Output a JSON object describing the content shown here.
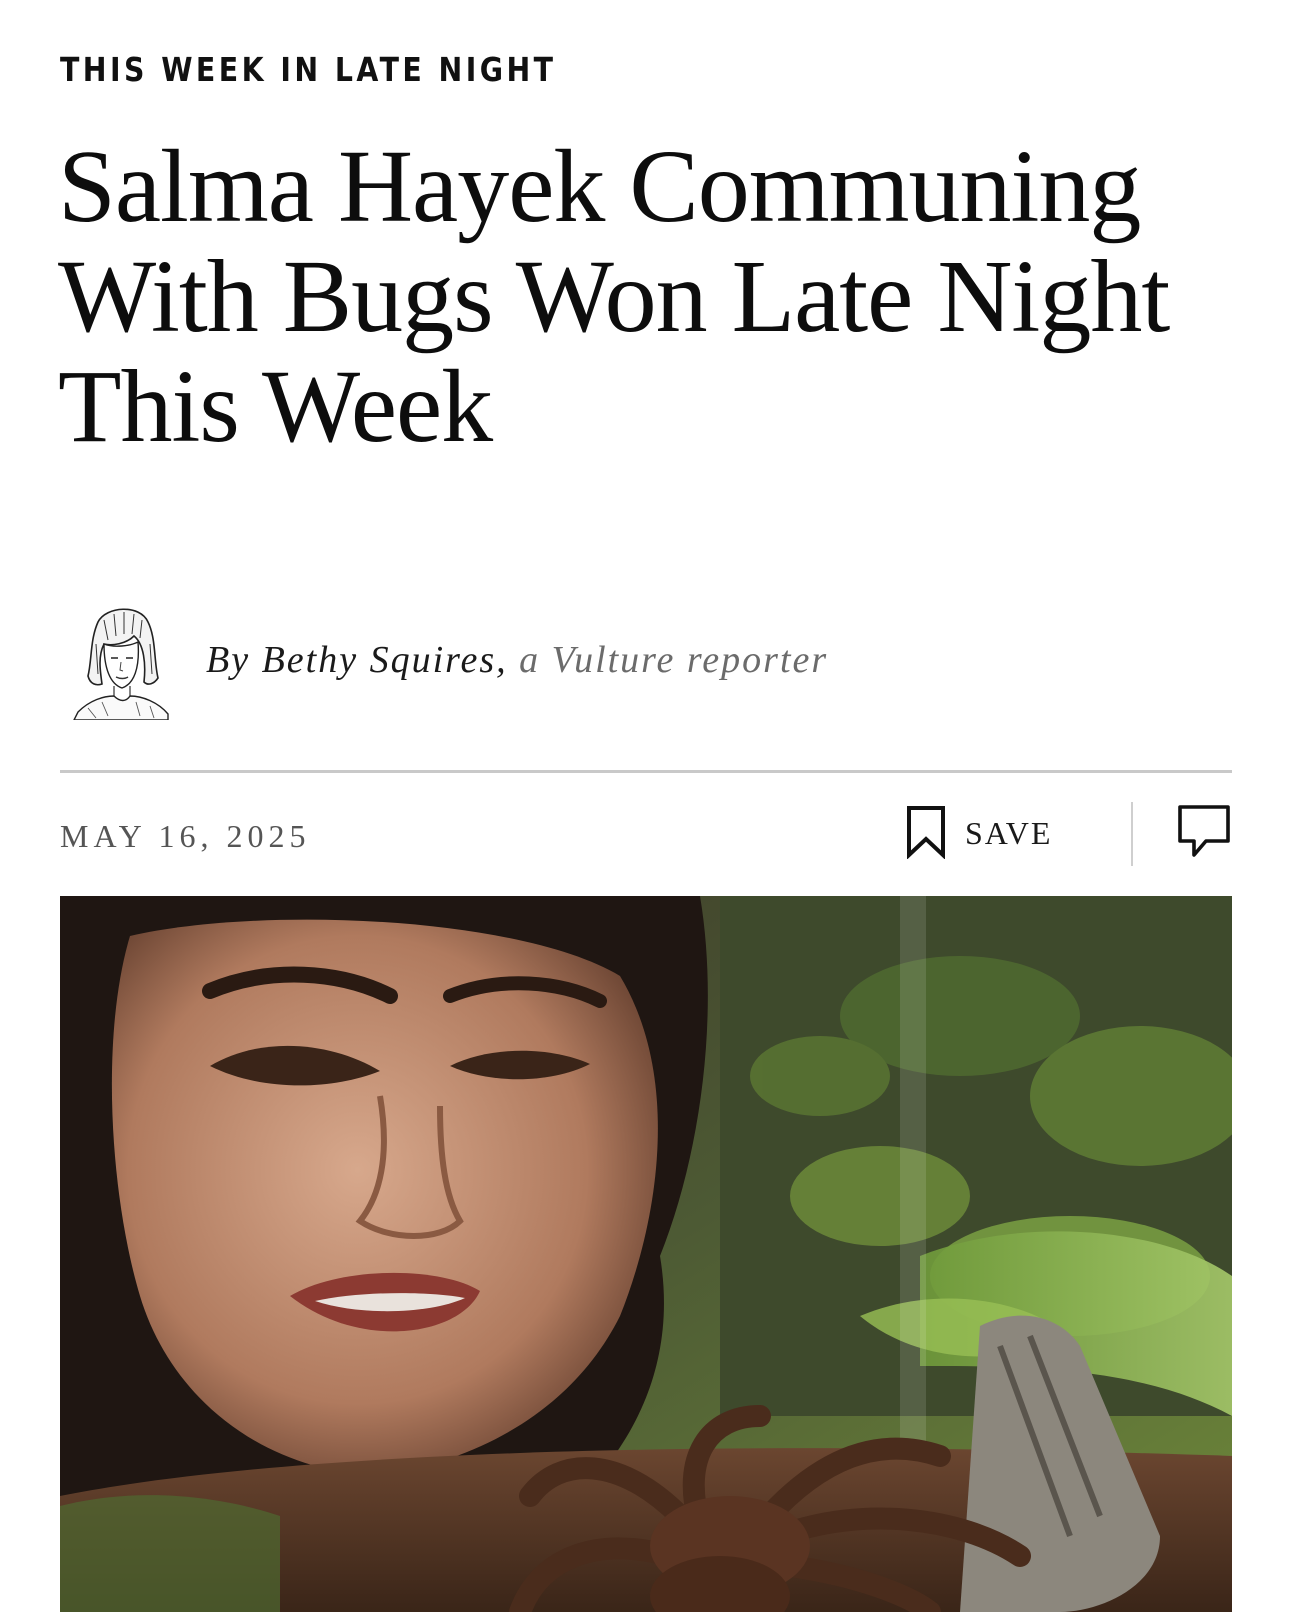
{
  "article": {
    "rubric": "THIS WEEK IN LATE NIGHT",
    "headline": "Salma Hayek Communing With Bugs Won Late Night This Week",
    "byline": {
      "author": "By Bethy Squires,",
      "role": "a Vulture reporter"
    },
    "date": "MAY 16, 2025"
  },
  "toolbar": {
    "save_label": "SAVE",
    "save_icon": "bookmark-icon",
    "comment_icon": "comment-icon"
  },
  "colors": {
    "text": "#111111",
    "muted": "#6b6b6b",
    "rule": "#c9c9c9"
  }
}
